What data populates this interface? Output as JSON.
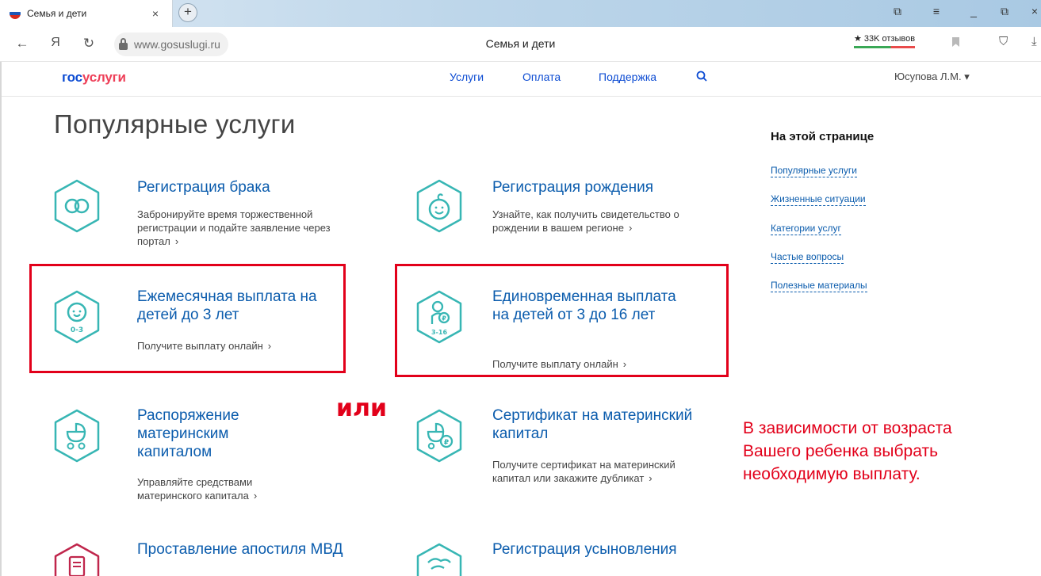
{
  "browser": {
    "tab_title": "Семья и дети",
    "tab_close": "×",
    "new_tab": "+",
    "url": "www.gosuslugi.ru",
    "page_title": "Семья и дети",
    "reviews": "★ 33K отзывов",
    "nav_back": "←",
    "nav_home": "Я",
    "nav_reload": "↻",
    "window_buttons": [
      "⧉",
      "≡",
      "_",
      "⧉",
      "×"
    ]
  },
  "site": {
    "logo_part1": "гос",
    "logo_part2": "услуги",
    "nav": [
      "Услуги",
      "Оплата",
      "Поддержка"
    ],
    "user": "Юсупова Л.М. ▾"
  },
  "main": {
    "heading": "Популярные услуги",
    "services": [
      {
        "title": "Регистрация брака",
        "desc": "Забронируйте время торжественной регистрации и подайте заявление через портал",
        "icon": "rings-icon"
      },
      {
        "title": "Регистрация рождения",
        "desc": "Узнайте, как получить свидетельство о рождении в вашем регионе",
        "icon": "baby-face-icon"
      },
      {
        "title": "Ежемесячная выплата на детей до 3 лет",
        "desc": "Получите выплату онлайн",
        "icon_label": "0-3",
        "icon": "baby-0-3-icon"
      },
      {
        "title": "Единовременная выплата на детей от 3 до 16 лет",
        "desc": "Получите выплату онлайн",
        "icon_label": "3-16",
        "icon": "child-coin-icon"
      },
      {
        "title": "Распоряжение материнским капиталом",
        "desc": "Управляйте средствами материнского капитала",
        "icon": "stroller-icon"
      },
      {
        "title": "Сертификат на материнский капитал",
        "desc": "Получите сертификат на материнский капитал или закажите дубликат",
        "icon": "stroller-coin-icon"
      },
      {
        "title": "Проставление апостиля МВД",
        "desc": "",
        "icon": "document-icon"
      },
      {
        "title": "Регистрация усыновления",
        "desc": "",
        "icon": "hands-icon"
      }
    ],
    "chevron": "›",
    "annotation_or": "или",
    "annotation_note": [
      "В зависимости от возраста",
      "Вашего ребенка выбрать",
      "необходимую  выплату."
    ]
  },
  "sidebar": {
    "title": "На этой странице",
    "links": [
      "Популярные услуги",
      "Жизненные ситуации",
      "Категории услуг",
      "Частые вопросы",
      "Полезные материалы"
    ]
  },
  "colors": {
    "teal": "#37b6b4",
    "link": "#0b5cad",
    "annotation": "#e2001a",
    "red_icon": "#c0264c"
  }
}
